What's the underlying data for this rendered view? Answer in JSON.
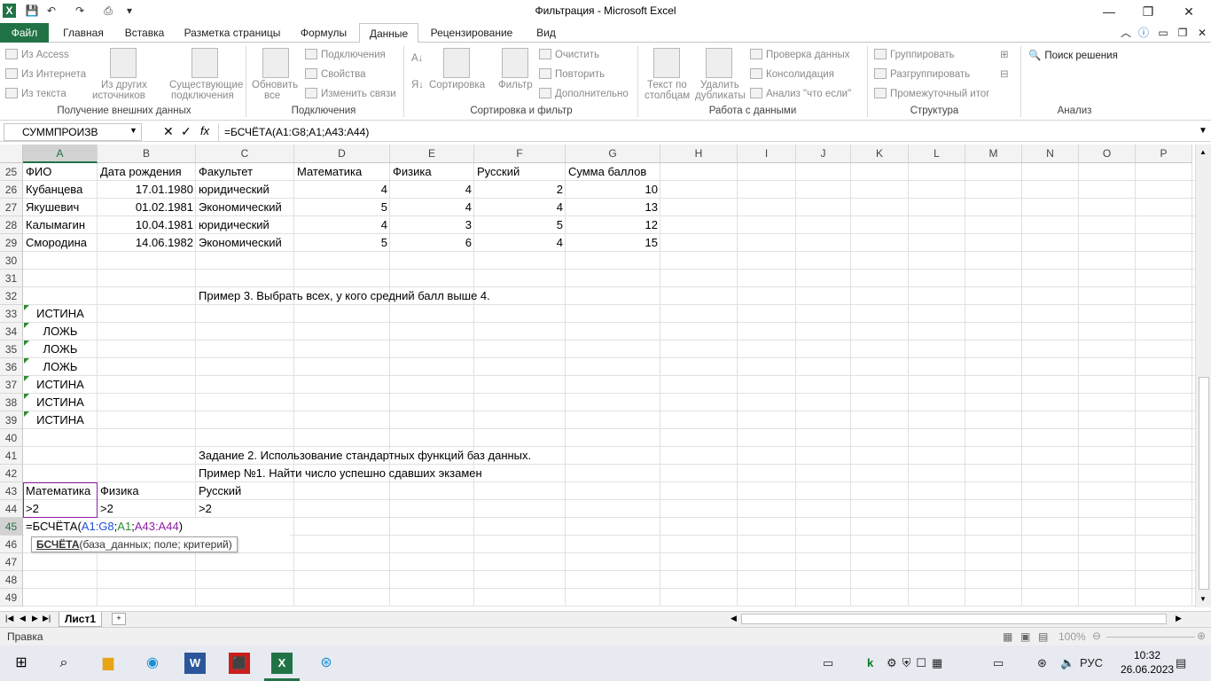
{
  "window": {
    "title": "Фильтрация  -  Microsoft Excel",
    "min": "—",
    "restore": "❐",
    "close": "✕"
  },
  "tabs": [
    "Файл",
    "Главная",
    "Вставка",
    "Разметка страницы",
    "Формулы",
    "Данные",
    "Рецензирование",
    "Вид"
  ],
  "ribbon": {
    "ext": {
      "access": "Из Access",
      "web": "Из Интернета",
      "text": "Из текста",
      "other1": "Из других",
      "other2": "источников",
      "exist1": "Существующие",
      "exist2": "подключения",
      "label": "Получение внешних данных"
    },
    "conn": {
      "refresh1": "Обновить",
      "refresh2": "все",
      "connections": "Подключения",
      "props": "Свойства",
      "links": "Изменить связи",
      "label": "Подключения"
    },
    "sort": {
      "sort": "Сортировка",
      "filter": "Фильтр",
      "clear": "Очистить",
      "reapply": "Повторить",
      "advanced": "Дополнительно",
      "label": "Сортировка и фильтр"
    },
    "tools": {
      "t2c1": "Текст по",
      "t2c2": "столбцам",
      "dup1": "Удалить",
      "dup2": "дубликаты",
      "validation": "Проверка данных",
      "consolidate": "Консолидация",
      "whatif": "Анализ \"что если\"",
      "label": "Работа с данными"
    },
    "outline": {
      "group": "Группировать",
      "ungroup": "Разгруппировать",
      "subtotal": "Промежуточный итог",
      "label": "Структура"
    },
    "analysis": {
      "solver": "Поиск решения",
      "label": "Анализ"
    }
  },
  "formula_bar": {
    "name": "СУММПРОИЗВ",
    "formula": "=БСЧЁТА(A1:G8;A1;A43:A44)"
  },
  "columns": [
    "A",
    "B",
    "C",
    "D",
    "E",
    "F",
    "G",
    "H",
    "I",
    "J",
    "K",
    "L",
    "M",
    "N",
    "O",
    "P"
  ],
  "rows": [
    "25",
    "26",
    "27",
    "28",
    "29",
    "30",
    "31",
    "32",
    "33",
    "34",
    "35",
    "36",
    "37",
    "38",
    "39",
    "40",
    "41",
    "42",
    "43",
    "44",
    "45",
    "46",
    "47",
    "48",
    "49"
  ],
  "cells": {
    "r25": [
      "ФИО",
      "Дата рождения",
      "Факультет",
      "Математика",
      "Физика",
      "Русский",
      "Сумма баллов"
    ],
    "r26": [
      "Кубанцева",
      "17.01.1980",
      "юридический",
      "4",
      "4",
      "2",
      "10"
    ],
    "r27": [
      "Якушевич",
      "01.02.1981",
      "Экономический",
      "5",
      "4",
      "4",
      "13"
    ],
    "r28": [
      "Калымагин",
      "10.04.1981",
      "юридический",
      "4",
      "3",
      "5",
      "12"
    ],
    "r29": [
      "Смородина",
      "14.06.1982",
      "Экономический",
      "5",
      "6",
      "4",
      "15"
    ],
    "r32": "Пример 3. Выбрать всех, у кого средний балл выше 4.",
    "r33": "ИСТИНА",
    "r34": "ЛОЖЬ",
    "r35": "ЛОЖЬ",
    "r36": "ЛОЖЬ",
    "r37": "ИСТИНА",
    "r38": "ИСТИНА",
    "r39": "ИСТИНА",
    "r41": "Задание 2. Использование стандартных функций баз данных.",
    "r42": "Пример №1. Найти число успешно сдавших экзамен",
    "r43": [
      "Математика",
      "Физика",
      "Русский"
    ],
    "r44": [
      ">2",
      ">2",
      ">2"
    ],
    "r45_prefix": "=БСЧЁТА(",
    "r45_a": "A1:G8",
    "r45_sep1": ";",
    "r45_b": "A1",
    "r45_sep2": ";",
    "r45_c": "A43:A44",
    "r45_suffix": ")"
  },
  "tooltip": {
    "fn": "БСЧЁТА",
    "args": "(база_данных; поле; критерий)"
  },
  "sheet": {
    "name": "Лист1"
  },
  "status": {
    "mode": "Правка",
    "zoom": "100%"
  },
  "taskbar": {
    "lang": "РУС",
    "time": "10:32",
    "date": "26.06.2023"
  },
  "colors": {
    "accent": "#217346",
    "ref_blue": "#1f4fd6",
    "ref_green": "#2e8b2e",
    "ref_purple": "#8e1ea6"
  }
}
